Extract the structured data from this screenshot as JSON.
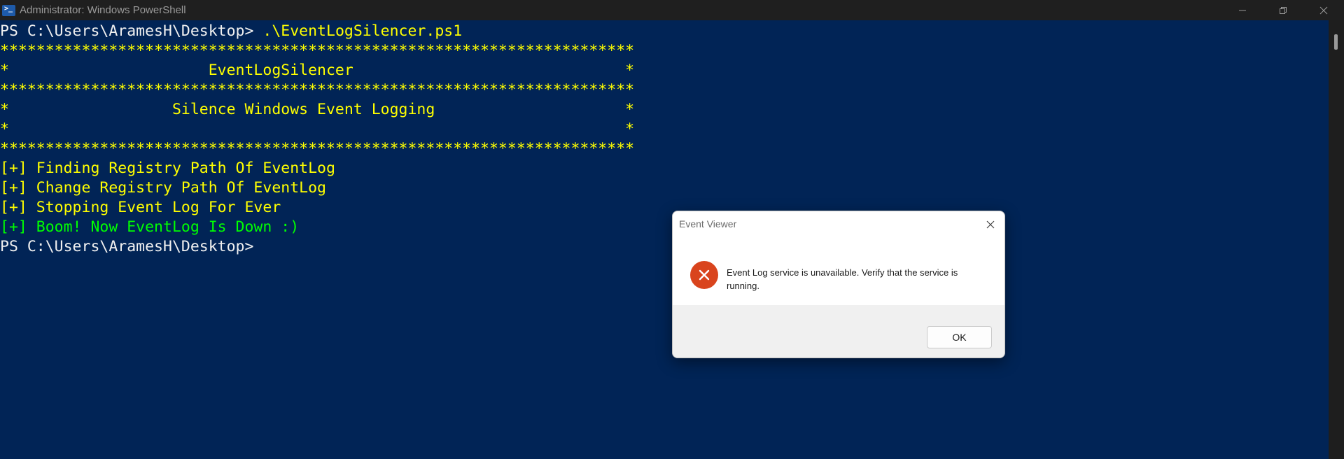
{
  "window": {
    "title": "Administrator: Windows PowerShell",
    "icon": "powershell-icon",
    "controls": [
      "minimize-icon",
      "restore-icon",
      "close-icon"
    ]
  },
  "console": {
    "prompt1": "PS C:\\Users\\AramesH\\Desktop> ",
    "command": ".\\EventLogSilencer.ps1",
    "banner": [
      "**********************************************************************",
      "*                      EventLogSilencer                              *",
      "**********************************************************************",
      "*                  Silence Windows Event Logging                     *",
      "*                                                                    *",
      "**********************************************************************"
    ],
    "output": [
      "[+] Finding Registry Path Of EventLog",
      "[+] Change Registry Path Of EventLog",
      "[+] Stopping Event Log For Ever"
    ],
    "success": "[+] Boom! Now EventLog Is Down :)",
    "prompt2": "PS C:\\Users\\AramesH\\Desktop>"
  },
  "dialog": {
    "title": "Event Viewer",
    "icon": "error-icon",
    "message": "Event Log service is unavailable. Verify that the service is running.",
    "ok_label": "OK"
  },
  "colors": {
    "console_bg": "#012456",
    "yellow": "#ffff00",
    "green": "#00ff00",
    "white": "#f0f0f0",
    "error_red": "#d9441d"
  }
}
